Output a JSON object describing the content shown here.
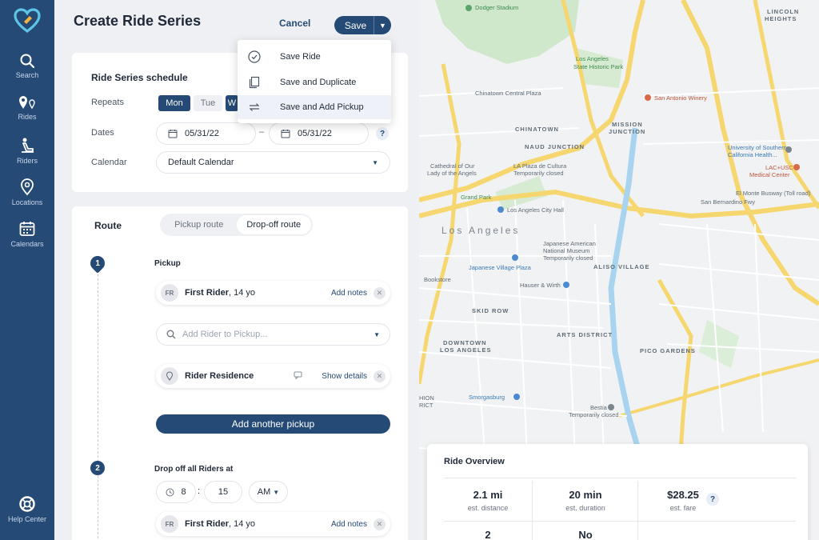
{
  "app": {
    "sidebar": {
      "items": [
        {
          "label": "Search",
          "icon": "search-icon"
        },
        {
          "label": "Rides",
          "icon": "rides-pin-icon"
        },
        {
          "label": "Riders",
          "icon": "rider-seat-icon"
        },
        {
          "label": "Locations",
          "icon": "location-pin-icon"
        },
        {
          "label": "Calendars",
          "icon": "calendar-icon"
        }
      ],
      "help": {
        "label": "Help Center",
        "icon": "lifebuoy-icon"
      }
    },
    "accent": "#244a75"
  },
  "header": {
    "title": "Create Ride Series",
    "cancel_label": "Cancel",
    "save_label": "Save"
  },
  "save_menu": {
    "items": [
      {
        "label": "Save Ride",
        "icon": "check-circle-icon"
      },
      {
        "label": "Save and Duplicate",
        "icon": "duplicate-icon"
      },
      {
        "label": "Save and Add Pickup",
        "icon": "repeat-icon"
      }
    ]
  },
  "schedule": {
    "title": "Ride Series schedule",
    "repeats_label": "Repeats",
    "days": [
      {
        "label": "Mon",
        "selected": true
      },
      {
        "label": "Tue",
        "selected": false
      },
      {
        "label": "W",
        "selected": true
      }
    ],
    "dates_label": "Dates",
    "start_date": "05/31/22",
    "date_separator": "–",
    "end_date": "05/31/22",
    "help_mark": "?",
    "calendar_label": "Calendar",
    "calendar_value": "Default Calendar"
  },
  "route": {
    "title": "Route",
    "tabs": [
      {
        "label": "Pickup route",
        "active": false
      },
      {
        "label": "Drop-off route",
        "active": true
      }
    ],
    "step1": {
      "number": "1",
      "heading": "Pickup",
      "rider": {
        "initials": "FR",
        "name": "First Rider",
        "age": ", 14 yo",
        "action": "Add notes"
      },
      "search_placeholder": "Add Rider to Pickup...",
      "location": {
        "name": "Rider Residence",
        "action": "Show details"
      },
      "add_button": "Add another pickup"
    },
    "step2": {
      "number": "2",
      "heading": "Drop off all Riders at",
      "hour": "8",
      "colon": ":",
      "minute": "15",
      "ampm": "AM",
      "rider": {
        "initials": "FR",
        "name": "First Rider",
        "age": ", 14 yo",
        "action": "Add notes"
      }
    }
  },
  "map": {
    "labels": {
      "dodger": "Dodger Stadium",
      "lincoln": "LINCOLN",
      "heights": "HEIGHTS",
      "la_state": "Los Angeles",
      "la_state2": "State Historic Park",
      "chinatown_plaza": "Chinatown Central Plaza",
      "chinatown": "CHINATOWN",
      "winery": "San Antonio Winery",
      "mission": "MISSION",
      "junction": "JUNCTION",
      "naud": "NAUD JUNCTION",
      "cathedral": "Cathedral of Our",
      "cathedral2": "Lady of the Angels",
      "laplaza": "LA Plaza de Cultura",
      "closed": "Temporarily closed",
      "usc": "University of Southern",
      "usc2": "California Health...",
      "lac": "LAC+USC",
      "lac2": "Medical Center",
      "grand": "Grand Park",
      "cityhall": "Los Angeles City Hall",
      "city": "Los Angeles",
      "jam": "Japanese American",
      "jam2": "National Museum",
      "jvp": "Japanese Village Plaza",
      "aliso": "ALISO VILLAGE",
      "bookstore": "Bookstore",
      "hauser": "Hauser & Wirth",
      "skid": "SKID ROW",
      "arts": "ARTS DISTRICT",
      "dtla": "DOWNTOWN",
      "dtla2": "LOS ANGELES",
      "pico": "PICO GARDENS",
      "smorg": "Smorgasburg",
      "bestia": "Bestia",
      "fashion": "HION",
      "fashion2": "RICT",
      "elmonte": "El Monte Busway (Toll road)",
      "sanbern": "San Bernardino Fwy"
    }
  },
  "overview": {
    "title": "Ride Overview",
    "stats": [
      {
        "value": "2.1 mi",
        "label": "est. distance"
      },
      {
        "value": "20 min",
        "label": "est. duration"
      },
      {
        "value": "$28.25",
        "label": "est. fare"
      }
    ],
    "help_mark": "?",
    "row2": [
      {
        "value": "2"
      },
      {
        "value": "No"
      }
    ]
  }
}
